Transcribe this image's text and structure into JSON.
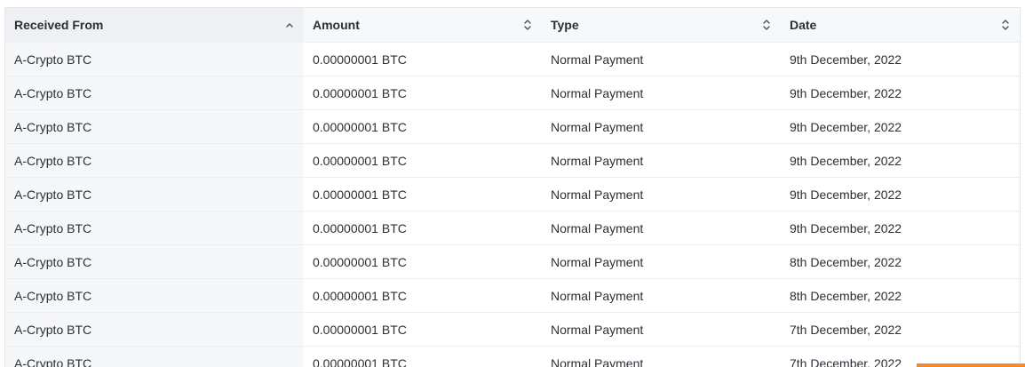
{
  "table": {
    "headers": [
      {
        "label": "Received From",
        "sort": "asc"
      },
      {
        "label": "Amount",
        "sort": "none"
      },
      {
        "label": "Type",
        "sort": "none"
      },
      {
        "label": "Date",
        "sort": "none"
      }
    ],
    "rows": [
      {
        "from": "A-Crypto BTC",
        "amount": "0.00000001 BTC",
        "type": "Normal Payment",
        "date": "9th December, 2022"
      },
      {
        "from": "A-Crypto BTC",
        "amount": "0.00000001 BTC",
        "type": "Normal Payment",
        "date": "9th December, 2022"
      },
      {
        "from": "A-Crypto BTC",
        "amount": "0.00000001 BTC",
        "type": "Normal Payment",
        "date": "9th December, 2022"
      },
      {
        "from": "A-Crypto BTC",
        "amount": "0.00000001 BTC",
        "type": "Normal Payment",
        "date": "9th December, 2022"
      },
      {
        "from": "A-Crypto BTC",
        "amount": "0.00000001 BTC",
        "type": "Normal Payment",
        "date": "9th December, 2022"
      },
      {
        "from": "A-Crypto BTC",
        "amount": "0.00000001 BTC",
        "type": "Normal Payment",
        "date": "9th December, 2022"
      },
      {
        "from": "A-Crypto BTC",
        "amount": "0.00000001 BTC",
        "type": "Normal Payment",
        "date": "8th December, 2022"
      },
      {
        "from": "A-Crypto BTC",
        "amount": "0.00000001 BTC",
        "type": "Normal Payment",
        "date": "8th December, 2022"
      },
      {
        "from": "A-Crypto BTC",
        "amount": "0.00000001 BTC",
        "type": "Normal Payment",
        "date": "7th December, 2022"
      },
      {
        "from": "A-Crypto BTC",
        "amount": "0.00000001 BTC",
        "type": "Normal Payment",
        "date": "7th December, 2022"
      }
    ]
  },
  "icons": {
    "sort_asc": "chevron-up-icon",
    "sort_unsorted": "sort-updown-icon"
  },
  "colors": {
    "accent": "#f28b2e",
    "header_bg": "#f6f8fa",
    "first_col_bg": "#f6f7f9",
    "text": "#2b2f36"
  }
}
